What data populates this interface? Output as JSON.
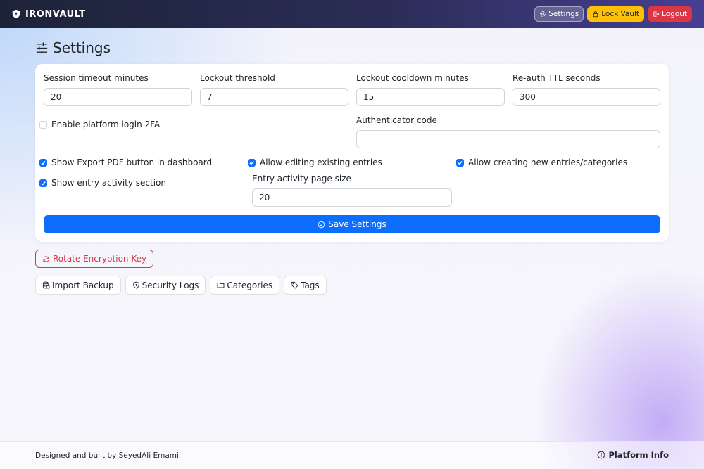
{
  "app": {
    "brand": "IRONVAULT"
  },
  "nav": {
    "settings_label": "Settings",
    "lock_label": "Lock Vault",
    "logout_label": "Logout"
  },
  "page": {
    "title": "Settings"
  },
  "form": {
    "session_timeout": {
      "label": "Session timeout minutes",
      "value": "20"
    },
    "lockout_threshold": {
      "label": "Lockout threshold",
      "value": "7"
    },
    "lockout_cooldown": {
      "label": "Lockout cooldown minutes",
      "value": "15"
    },
    "reauth_ttl": {
      "label": "Re-auth TTL seconds",
      "value": "300"
    },
    "platform_2fa": {
      "label": "Enable platform login 2FA",
      "checked": false
    },
    "authenticator_code": {
      "label": "Authenticator code",
      "value": ""
    },
    "show_export_pdf": {
      "label": "Show Export PDF button in dashboard",
      "checked": true
    },
    "allow_editing": {
      "label": "Allow editing existing entries",
      "checked": true
    },
    "allow_creating": {
      "label": "Allow creating new entries/categories",
      "checked": true
    },
    "show_activity": {
      "label": "Show entry activity section",
      "checked": true
    },
    "activity_page_size": {
      "label": "Entry activity page size",
      "value": "20"
    },
    "save_label": "Save Settings"
  },
  "actions": {
    "rotate_label": "Rotate Encryption Key",
    "import_label": "Import Backup",
    "security_logs_label": "Security Logs",
    "categories_label": "Categories",
    "tags_label": "Tags"
  },
  "footer": {
    "credit": "Designed and built by SeyedAli Emami.",
    "platform_info_label": "Platform Info"
  },
  "colors": {
    "primary": "#0d6efd",
    "warning": "#ffc107",
    "danger": "#dc3545",
    "navbar_start": "#1d2338",
    "navbar_end": "#473f92"
  }
}
